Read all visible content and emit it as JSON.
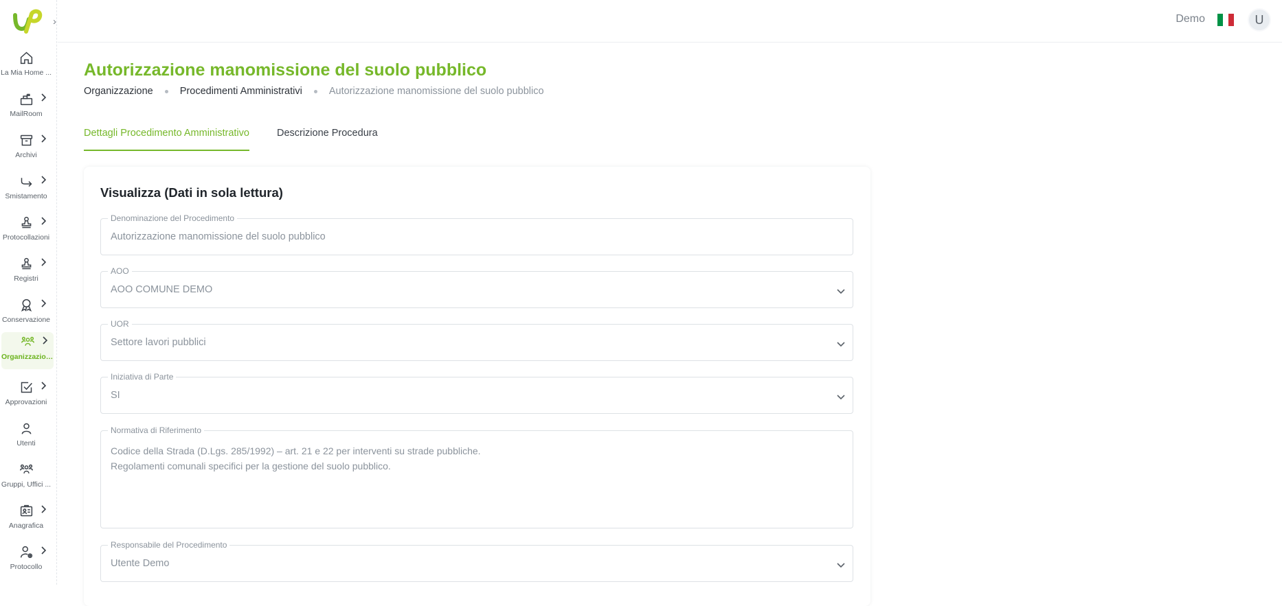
{
  "topbar": {
    "user_name": "Demo",
    "avatar_initial": "U",
    "flag_colors": [
      "#009246",
      "#ffffff",
      "#ce2b37"
    ]
  },
  "sidebar": {
    "items": [
      {
        "label": "La Mia Home ...",
        "icon": "home-icon"
      },
      {
        "label": "MailRoom",
        "icon": "mailbox-icon"
      },
      {
        "label": "Archivi",
        "icon": "archive-icon"
      },
      {
        "label": "Smistamento",
        "icon": "forward-icon"
      },
      {
        "label": "Protocollazioni",
        "icon": "stamp-icon"
      },
      {
        "label": "Registri",
        "icon": "stamp-icon"
      },
      {
        "label": "Conservazione",
        "icon": "award-icon"
      },
      {
        "label": "Organizzazione",
        "icon": "users-icon"
      },
      {
        "label": "Approvazioni",
        "icon": "checkbox-icon"
      },
      {
        "label": "Utenti",
        "icon": "user-icon"
      },
      {
        "label": "Gruppi, Uffici ...",
        "icon": "group-icon"
      },
      {
        "label": "Anagrafica",
        "icon": "id-card-icon"
      },
      {
        "label": "Protocollo",
        "icon": "user-settings-icon"
      }
    ]
  },
  "page": {
    "title": "Autorizzazione manomissione del suolo pubblico",
    "breadcrumb": [
      "Organizzazione",
      "Procedimenti Amministrativi",
      "Autorizzazione manomissione del suolo pubblico"
    ],
    "tabs": [
      "Dettagli Procedimento Amministrativo",
      "Descrizione Procedura"
    ]
  },
  "form": {
    "title": "Visualizza (Dati in sola lettura)",
    "denominazione": {
      "label": "Denominazione del Procedimento",
      "value": "Autorizzazione manomissione del suolo pubblico"
    },
    "aoo": {
      "label": "AOO",
      "value": "AOO COMUNE DEMO"
    },
    "uor": {
      "label": "UOR",
      "value": "Settore lavori pubblici"
    },
    "iniziativa": {
      "label": "Iniziativa di Parte",
      "value": "SI"
    },
    "normativa": {
      "label": "Normativa di Riferimento",
      "lines": [
        "Codice della Strada (D.Lgs. 285/1992) – art. 21 e 22 per interventi su strade pubbliche.",
        "Regolamenti comunali specifici per la gestione del suolo pubblico."
      ]
    },
    "responsabile": {
      "label": "Responsabile del Procedimento",
      "value": "Utente Demo"
    }
  },
  "colors": {
    "accent": "#76b82a",
    "text_muted": "#8b939c"
  }
}
